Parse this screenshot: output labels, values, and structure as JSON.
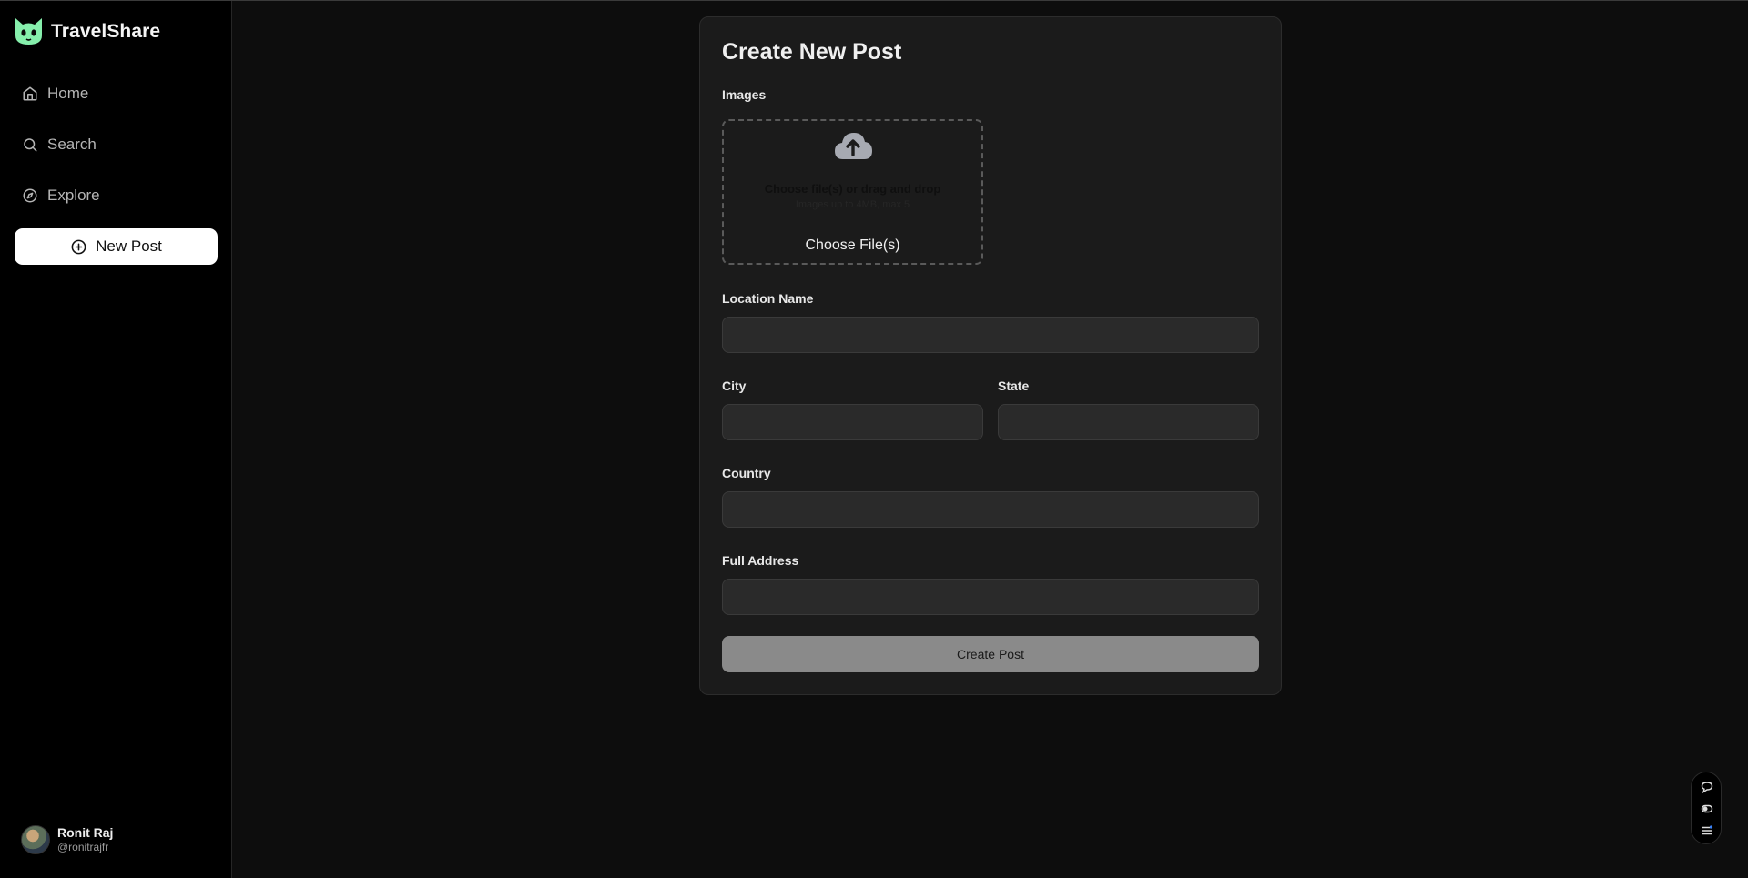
{
  "app": {
    "name": "TravelShare",
    "logo_icon": "cat-face-logo",
    "brand_color": "#86efac"
  },
  "sidebar": {
    "items": [
      {
        "label": "Home",
        "icon": "home-icon"
      },
      {
        "label": "Search",
        "icon": "search-icon"
      },
      {
        "label": "Explore",
        "icon": "compass-icon"
      }
    ],
    "new_post_label": "New Post"
  },
  "user": {
    "name": "Ronit Raj",
    "handle": "@ronitrajfr"
  },
  "form": {
    "title": "Create New Post",
    "images_label": "Images",
    "dropzone_text": "Choose file(s) or drag and drop",
    "dropzone_subtext": "Images up to 4MB, max 5",
    "dropzone_button": "Choose File(s)",
    "location_label": "Location Name",
    "location_value": "",
    "city_label": "City",
    "city_value": "",
    "state_label": "State",
    "state_value": "",
    "country_label": "Country",
    "country_value": "",
    "address_label": "Full Address",
    "address_value": "",
    "submit_label": "Create Post"
  },
  "toolbar": {
    "icons": [
      "chat-icon",
      "toggle-icon",
      "menu-icon"
    ]
  }
}
